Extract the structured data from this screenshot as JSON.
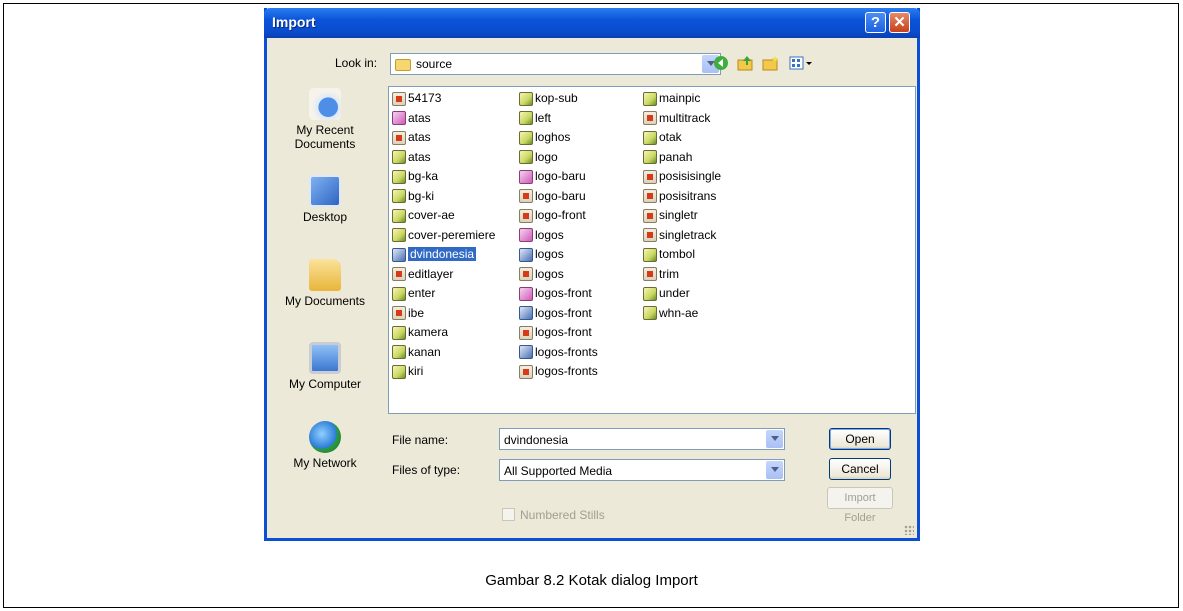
{
  "dialog": {
    "title": "Import",
    "help_glyph": "?",
    "close_glyph": "✕",
    "look_in_label": "Look in:",
    "look_in_value": "source",
    "toolbar_icons": [
      "back-icon",
      "up-folder-icon",
      "new-folder-icon",
      "view-menu-icon"
    ]
  },
  "places": [
    {
      "label": "My Recent Documents",
      "icon": "recent-documents-icon"
    },
    {
      "label": "Desktop",
      "icon": "desktop-icon"
    },
    {
      "label": "My Documents",
      "icon": "my-documents-icon"
    },
    {
      "label": "My Computer",
      "icon": "my-computer-icon"
    },
    {
      "label": "My Network",
      "icon": "my-network-icon"
    }
  ],
  "files": {
    "col1": [
      {
        "name": "54173",
        "type": "psd"
      },
      {
        "name": "atas",
        "type": "jpg"
      },
      {
        "name": "atas",
        "type": "psd"
      },
      {
        "name": "atas",
        "type": "png"
      },
      {
        "name": "bg-ka",
        "type": "png"
      },
      {
        "name": "bg-ki",
        "type": "png"
      },
      {
        "name": "cover-ae",
        "type": "png"
      },
      {
        "name": "cover-peremiere",
        "type": "png"
      },
      {
        "name": "dvindonesia",
        "type": "ai",
        "selected": true
      },
      {
        "name": "editlayer",
        "type": "psd"
      },
      {
        "name": "enter",
        "type": "png"
      },
      {
        "name": "ibe",
        "type": "psd"
      },
      {
        "name": "kamera",
        "type": "png"
      },
      {
        "name": "kanan",
        "type": "png"
      },
      {
        "name": "kiri",
        "type": "png"
      }
    ],
    "col2": [
      {
        "name": "kop-sub",
        "type": "png"
      },
      {
        "name": "left",
        "type": "png"
      },
      {
        "name": "loghos",
        "type": "png"
      },
      {
        "name": "logo",
        "type": "png"
      },
      {
        "name": "logo-baru",
        "type": "jpg"
      },
      {
        "name": "logo-baru",
        "type": "psd"
      },
      {
        "name": "logo-front",
        "type": "psd"
      },
      {
        "name": "logos",
        "type": "jpg"
      },
      {
        "name": "logos",
        "type": "ai"
      },
      {
        "name": "logos",
        "type": "psd"
      },
      {
        "name": "logos-front",
        "type": "jpg"
      },
      {
        "name": "logos-front",
        "type": "ai"
      },
      {
        "name": "logos-front",
        "type": "psd"
      },
      {
        "name": "logos-fronts",
        "type": "ai"
      },
      {
        "name": "logos-fronts",
        "type": "psd"
      }
    ],
    "col3": [
      {
        "name": "mainpic",
        "type": "png"
      },
      {
        "name": "multitrack",
        "type": "psd"
      },
      {
        "name": "otak",
        "type": "png"
      },
      {
        "name": "panah",
        "type": "png"
      },
      {
        "name": "posisisingle",
        "type": "psd"
      },
      {
        "name": "posisitrans",
        "type": "psd"
      },
      {
        "name": "singletr",
        "type": "psd"
      },
      {
        "name": "singletrack",
        "type": "psd"
      },
      {
        "name": "tombol",
        "type": "png"
      },
      {
        "name": "trim",
        "type": "psd"
      },
      {
        "name": "under",
        "type": "png"
      },
      {
        "name": "whn-ae",
        "type": "png"
      }
    ]
  },
  "form": {
    "file_name_label": "File name:",
    "file_name_value": "dvindonesia",
    "file_type_label": "Files of type:",
    "file_type_value": "All Supported Media",
    "numbered_stills_label": "Numbered Stills",
    "numbered_stills_checked": false
  },
  "buttons": {
    "open": "Open",
    "cancel": "Cancel",
    "import_folder": "Import Folder"
  },
  "caption": "Gambar 8.2 Kotak dialog Import"
}
